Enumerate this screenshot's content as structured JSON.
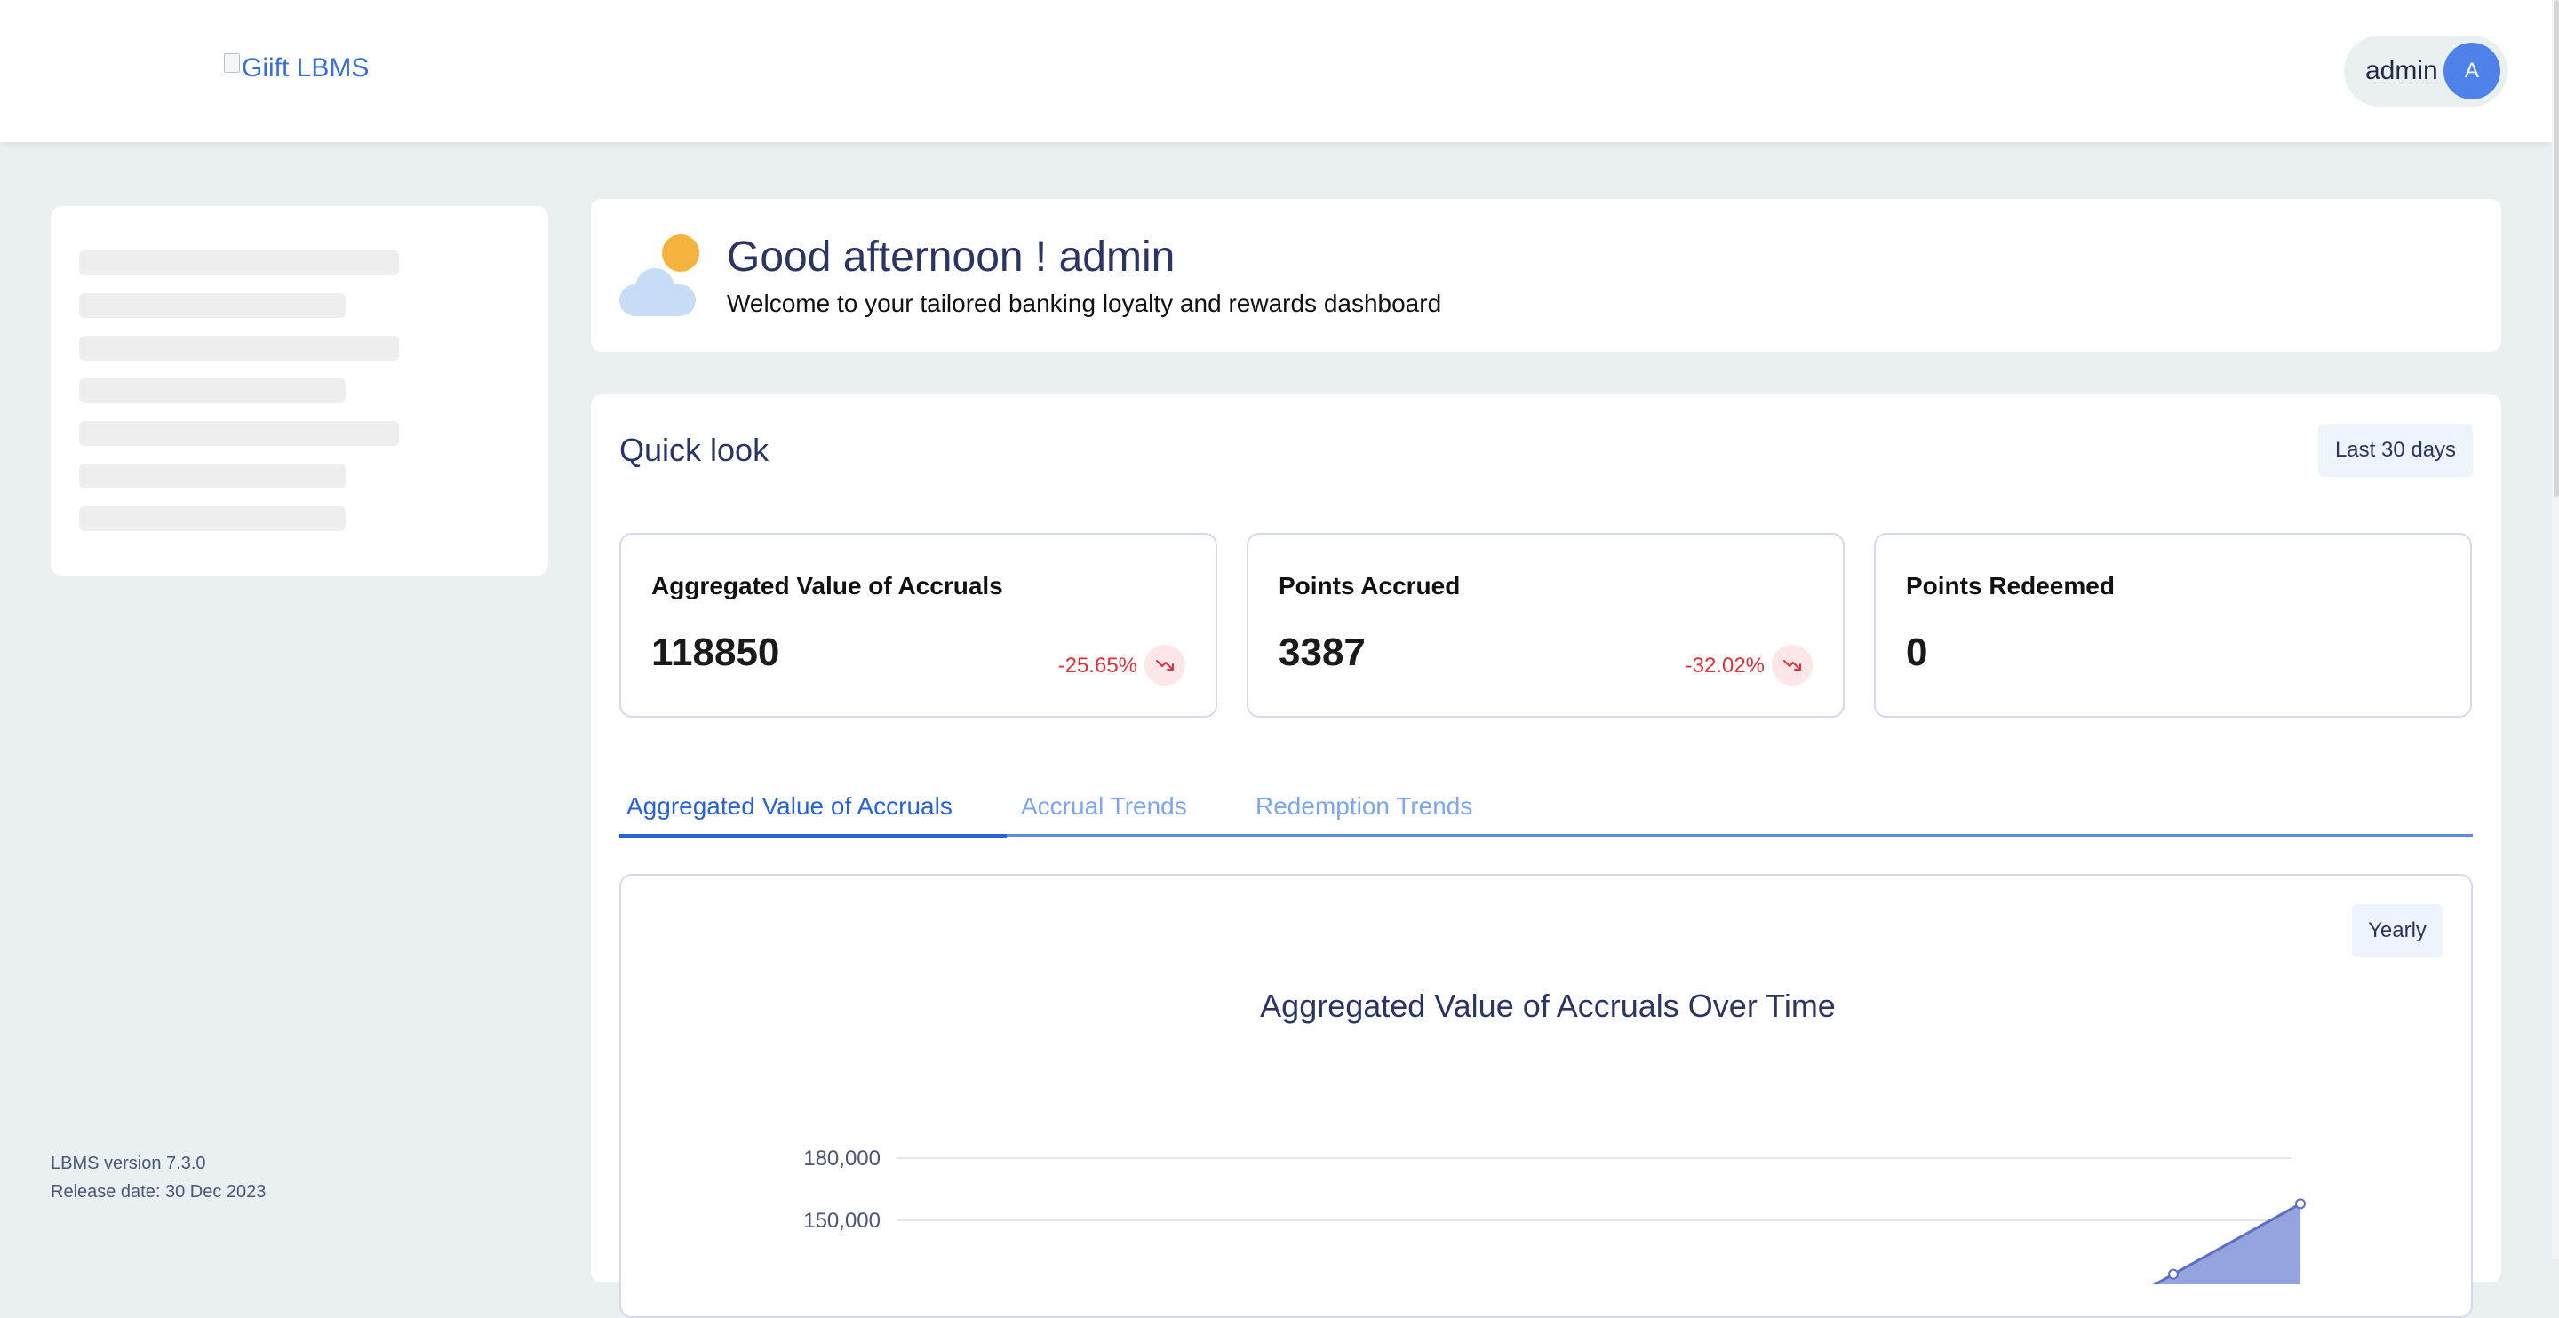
{
  "header": {
    "logo_alt": "Giift LBMS",
    "user_name": "admin",
    "avatar_initial": "A"
  },
  "sidebar": {
    "version": "LBMS version 7.3.0",
    "release_date": "Release date: 30 Dec 2023"
  },
  "greeting": {
    "title": "Good afternoon ! admin",
    "subtitle": "Welcome to your tailored banking loyalty and rewards dashboard"
  },
  "quick_look": {
    "title": "Quick look",
    "range_label": "Last 30 days",
    "cards": [
      {
        "title": "Aggregated Value of Accruals",
        "value": "118850",
        "delta": "-25.65%"
      },
      {
        "title": "Points Accrued",
        "value": "3387",
        "delta": "-32.02%"
      },
      {
        "title": "Points Redeemed",
        "value": "0",
        "delta": ""
      }
    ]
  },
  "tabs": [
    {
      "label": "Aggregated Value of Accruals",
      "active": true
    },
    {
      "label": "Accrual Trends",
      "active": false
    },
    {
      "label": "Redemption Trends",
      "active": false
    }
  ],
  "chart_panel": {
    "period_label": "Yearly"
  },
  "chart_data": {
    "type": "area",
    "title": "Aggregated Value of Accruals Over Time",
    "xlabel": "",
    "ylabel": "",
    "y_ticks": [
      150000,
      180000
    ],
    "y_tick_labels": [
      "150,000",
      "180,000"
    ],
    "ylim": [
      120000,
      180000
    ],
    "series": [
      {
        "values": [
          124000,
          158000
        ]
      }
    ],
    "grid": true,
    "fill_color": "#8a9ad8",
    "line_color": "#5b6fc9"
  },
  "colors": {
    "accent": "#2a62d9",
    "negative": "#e0303a",
    "background": "#eaeff2"
  }
}
